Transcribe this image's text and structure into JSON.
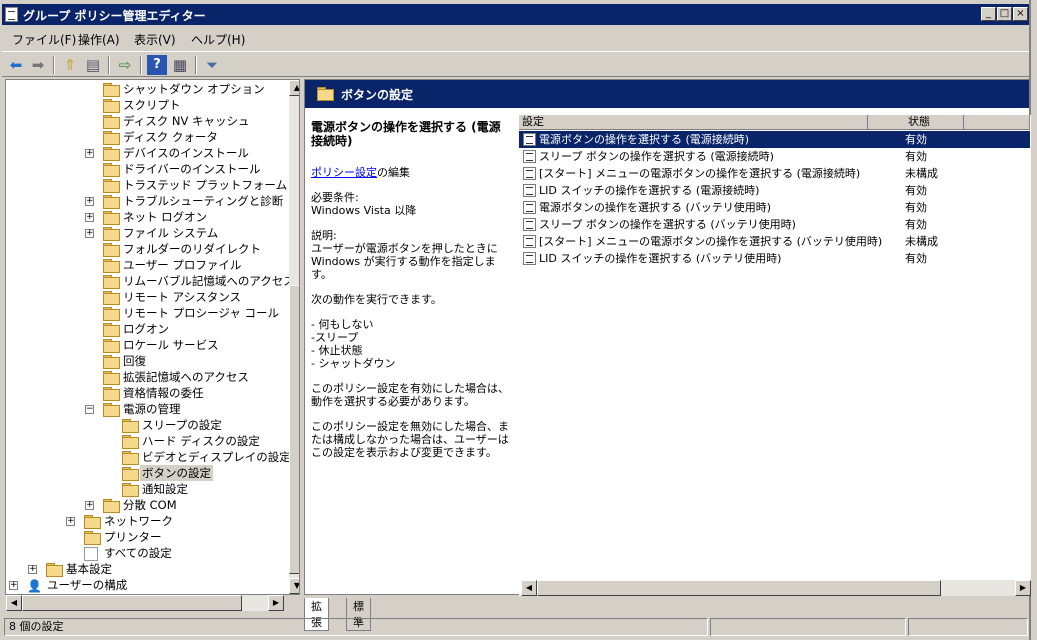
{
  "window": {
    "title": "グループ ポリシー管理エディター",
    "controls": {
      "minimize": "_",
      "maximize": "□",
      "close": "×"
    }
  },
  "menu": [
    "ファイル(F)",
    "操作(A)",
    "表示(V)",
    "ヘルプ(H)"
  ],
  "toolbar_icons": [
    "back-icon",
    "forward-icon",
    "up-folder-icon",
    "show-hide-tree-icon",
    "export-list-icon",
    "help-icon",
    "properties-icon",
    "filter-icon"
  ],
  "tree": {
    "rows": [
      {
        "label": "シャットダウン オプション",
        "indent": 5,
        "exp": ""
      },
      {
        "label": "スクリプト",
        "indent": 5,
        "exp": ""
      },
      {
        "label": "ディスク NV キャッシュ",
        "indent": 5,
        "exp": ""
      },
      {
        "label": "ディスク クォータ",
        "indent": 5,
        "exp": ""
      },
      {
        "label": "デバイスのインストール",
        "indent": 5,
        "exp": "+"
      },
      {
        "label": "ドライバーのインストール",
        "indent": 5,
        "exp": ""
      },
      {
        "label": "トラステッド プラットフォーム モジュ",
        "indent": 5,
        "exp": ""
      },
      {
        "label": "トラブルシューティングと診断",
        "indent": 5,
        "exp": "+"
      },
      {
        "label": "ネット ログオン",
        "indent": 5,
        "exp": "+"
      },
      {
        "label": "ファイル システム",
        "indent": 5,
        "exp": "+"
      },
      {
        "label": "フォルダーのリダイレクト",
        "indent": 5,
        "exp": ""
      },
      {
        "label": "ユーザー プロファイル",
        "indent": 5,
        "exp": ""
      },
      {
        "label": "リムーバブル記憶域へのアクセス",
        "indent": 5,
        "exp": ""
      },
      {
        "label": "リモート アシスタンス",
        "indent": 5,
        "exp": ""
      },
      {
        "label": "リモート プロシージャ コール",
        "indent": 5,
        "exp": ""
      },
      {
        "label": "ログオン",
        "indent": 5,
        "exp": ""
      },
      {
        "label": "ロケール サービス",
        "indent": 5,
        "exp": ""
      },
      {
        "label": "回復",
        "indent": 5,
        "exp": ""
      },
      {
        "label": "拡張記憶域へのアクセス",
        "indent": 5,
        "exp": ""
      },
      {
        "label": "資格情報の委任",
        "indent": 5,
        "exp": ""
      },
      {
        "label": "電源の管理",
        "indent": 5,
        "exp": "−"
      },
      {
        "label": "スリープの設定",
        "indent": 6,
        "exp": ""
      },
      {
        "label": "ハード ディスクの設定",
        "indent": 6,
        "exp": ""
      },
      {
        "label": "ビデオとディスプレイの設定",
        "indent": 6,
        "exp": ""
      },
      {
        "label": "ボタンの設定",
        "indent": 6,
        "exp": "",
        "selected": true
      },
      {
        "label": "通知設定",
        "indent": 6,
        "exp": ""
      },
      {
        "label": "分散 COM",
        "indent": 5,
        "exp": "+"
      },
      {
        "label": "ネットワーク",
        "indent": 4,
        "exp": "+"
      },
      {
        "label": "プリンター",
        "indent": 4,
        "exp": ""
      },
      {
        "label": "すべての設定",
        "indent": 4,
        "exp": "",
        "icon": "settings-icon"
      },
      {
        "label": "基本設定",
        "indent": 2,
        "exp": "+"
      },
      {
        "label": "ユーザーの構成",
        "indent": 1,
        "exp": "+",
        "icon": "user-config-icon"
      }
    ]
  },
  "details": {
    "header": "ボタンの設定",
    "title": "電源ボタンの操作を選択する (電源接続時)",
    "policy_link": "ポリシー設定",
    "policy_link_suffix": "の編集",
    "requirements_label": "必要条件:",
    "requirements": "Windows Vista 以降",
    "description_label": "説明:",
    "description": "ユーザーが電源ボタンを押したときに Windows が実行する動作を指定します。",
    "actions_intro": "次の動作を実行できます。",
    "actions": [
      "- 何もしない",
      "-スリープ",
      "- 休止状態",
      "- シャットダウン"
    ],
    "enabled_note": "このポリシー設定を有効にした場合は、動作を選択する必要があります。",
    "disabled_note": "このポリシー設定を無効にした場合、または構成しなかった場合は、ユーザーはこの設定を表示および変更できます。"
  },
  "list": {
    "columns": [
      "設定",
      "状態"
    ],
    "rows": [
      {
        "name": "電源ボタンの操作を選択する (電源接続時)",
        "state": "有効",
        "selected": true
      },
      {
        "name": "スリープ ボタンの操作を選択する (電源接続時)",
        "state": "有効"
      },
      {
        "name": "[スタート] メニューの電源ボタンの操作を選択する (電源接続時)",
        "state": "未構成"
      },
      {
        "name": "LID スイッチの操作を選択する (電源接続時)",
        "state": "有効"
      },
      {
        "name": "電源ボタンの操作を選択する (バッテリ使用時)",
        "state": "有効"
      },
      {
        "name": "スリープ ボタンの操作を選択する (バッテリ使用時)",
        "state": "有効"
      },
      {
        "name": "[スタート] メニューの電源ボタンの操作を選択する (バッテリ使用時)",
        "state": "未構成"
      },
      {
        "name": "LID スイッチの操作を選択する (バッテリ使用時)",
        "state": "有効"
      }
    ]
  },
  "tabs": {
    "extended": "拡張",
    "standard": "標準"
  },
  "status": {
    "text": "8 個の設定"
  },
  "colors": {
    "selection": "#0a246a",
    "face": "#d4d0c8",
    "folder": "#f7d98b"
  }
}
